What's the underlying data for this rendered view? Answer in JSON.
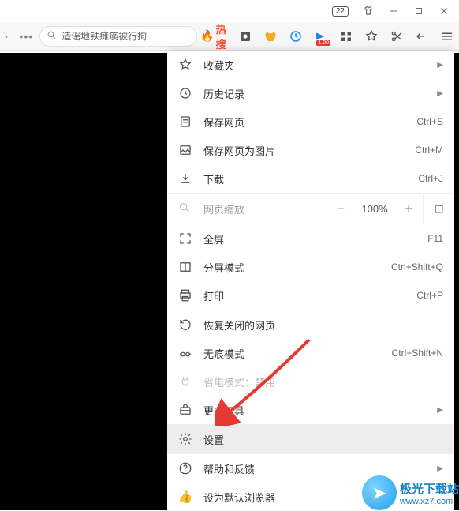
{
  "titlebar": {
    "counter": "22"
  },
  "toolbar": {
    "search_text": "造谣地铁瘫痪被行拘",
    "hot_label": "热搜",
    "video_badge": "1.00"
  },
  "menu": {
    "favorites": "收藏夹",
    "history": "历史记录",
    "save_page": "保存网页",
    "save_page_sc": "Ctrl+S",
    "save_image": "保存网页为图片",
    "save_image_sc": "Ctrl+M",
    "downloads": "下载",
    "downloads_sc": "Ctrl+J",
    "zoom_label": "网页缩放",
    "zoom_minus": "−",
    "zoom_value": "100%",
    "zoom_plus": "+",
    "fullscreen": "全屏",
    "fullscreen_sc": "F11",
    "split": "分屏模式",
    "split_sc": "Ctrl+Shift+Q",
    "print": "打印",
    "print_sc": "Ctrl+P",
    "restore": "恢复关闭的网页",
    "incognito": "无痕模式",
    "incognito_sc": "Ctrl+Shift+N",
    "power": "省电模式：禁用",
    "more_tools": "更多工具",
    "settings": "设置",
    "help": "帮助和反馈",
    "default_browser": "设为默认浏览器"
  },
  "watermark": {
    "cn": "极光下载站",
    "url": "www.xz7.com"
  }
}
